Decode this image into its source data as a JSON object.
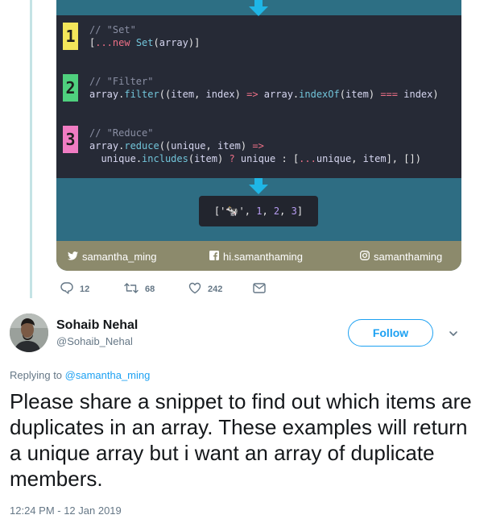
{
  "previous_tweet": {
    "image_card": {
      "snippets": [
        {
          "number": "1",
          "badge_color": "#f3e65a",
          "comment": "// \"Set\"",
          "lines": [
            [
              [
                "c-punc",
                "["
              ],
              [
                "c-kw",
                "..."
              ],
              [
                "c-kw",
                "new "
              ],
              [
                "c-fn",
                "Set"
              ],
              [
                "c-punc",
                "("
              ],
              [
                "c-var",
                "array"
              ],
              [
                "c-punc",
                ")]"
              ]
            ]
          ]
        },
        {
          "number": "2",
          "badge_color": "#4fd07e",
          "comment": "// \"Filter\"",
          "lines": [
            [
              [
                "c-var",
                "array"
              ],
              [
                "c-punc",
                "."
              ],
              [
                "c-fn",
                "filter"
              ],
              [
                "c-punc",
                "(("
              ],
              [
                "c-var",
                "item"
              ],
              [
                "c-punc",
                ", "
              ],
              [
                "c-var",
                "index"
              ],
              [
                "c-punc",
                ") "
              ],
              [
                "c-op",
                "=>"
              ],
              [
                "c-punc",
                " "
              ],
              [
                "c-var",
                "array"
              ],
              [
                "c-punc",
                "."
              ],
              [
                "c-fn",
                "indexOf"
              ],
              [
                "c-punc",
                "("
              ],
              [
                "c-var",
                "item"
              ],
              [
                "c-punc",
                ") "
              ],
              [
                "c-op",
                "==="
              ],
              [
                "c-punc",
                " "
              ],
              [
                "c-var",
                "index"
              ],
              [
                "c-punc",
                ")"
              ]
            ]
          ]
        },
        {
          "number": "3",
          "badge_color": "#f07cc3",
          "comment": "// \"Reduce\"",
          "lines": [
            [
              [
                "c-var",
                "array"
              ],
              [
                "c-punc",
                "."
              ],
              [
                "c-fn",
                "reduce"
              ],
              [
                "c-punc",
                "(("
              ],
              [
                "c-var",
                "unique"
              ],
              [
                "c-punc",
                ", "
              ],
              [
                "c-var",
                "item"
              ],
              [
                "c-punc",
                ") "
              ],
              [
                "c-op",
                "=>"
              ]
            ],
            [
              [
                "c-punc",
                "  "
              ],
              [
                "c-var",
                "unique"
              ],
              [
                "c-punc",
                "."
              ],
              [
                "c-fn",
                "includes"
              ],
              [
                "c-punc",
                "("
              ],
              [
                "c-var",
                "item"
              ],
              [
                "c-punc",
                ") "
              ],
              [
                "c-op",
                "?"
              ],
              [
                "c-punc",
                " "
              ],
              [
                "c-var",
                "unique"
              ],
              [
                "c-punc",
                " : ["
              ],
              [
                "c-kw",
                "..."
              ],
              [
                "c-var",
                "unique"
              ],
              [
                "c-punc",
                ", "
              ],
              [
                "c-var",
                "item"
              ],
              [
                "c-punc",
                "], [])"
              ]
            ]
          ]
        }
      ],
      "result": {
        "open": "['",
        "emoji": "🐄",
        "after_emoji": "', ",
        "nums": [
          "1",
          "2",
          "3"
        ],
        "close": "]"
      },
      "footer": {
        "twitter": "samantha_ming",
        "facebook": "hi.samanthaming",
        "instagram": "samanthaming"
      },
      "colors": {
        "code_bg": "#262a36",
        "teal": "#2e6d83",
        "footer_bg": "#8c8a6c",
        "arrow": "#1fb6e6"
      }
    },
    "actions": {
      "reply_count": "12",
      "retweet_count": "68",
      "like_count": "242"
    }
  },
  "reply": {
    "name": "Sohaib Nehal",
    "handle": "@Sohaib_Nehal",
    "follow_label": "Follow",
    "replying_prefix": "Replying to ",
    "replying_to": "@samantha_ming",
    "text": "Please share a snippet to find out which items are duplicates in an array. These examples will return a unique array but i want an array of duplicate members.",
    "timestamp": "12:24 PM - 12 Jan 2019"
  },
  "icons": [
    "twitter-bird-icon",
    "facebook-icon",
    "instagram-icon",
    "reply-icon",
    "retweet-icon",
    "heart-icon",
    "mail-icon",
    "chevron-down-icon",
    "arrow-down-icon"
  ],
  "brand_color": "#1da1f2"
}
